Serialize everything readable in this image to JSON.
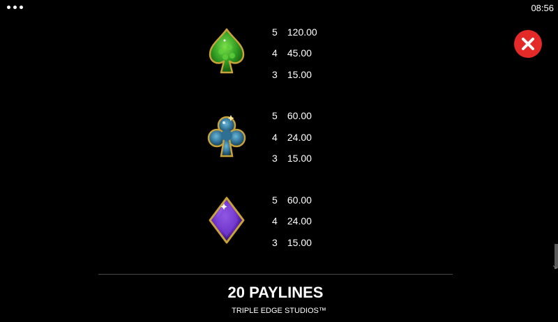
{
  "top_bar": {
    "clock": "08:56"
  },
  "colors": {
    "close_button": "#e32a28",
    "spade": "#3fae2a",
    "club": "#3a7fa8",
    "diamond": "#7a3fd0",
    "gold_border": "#c9a23a"
  },
  "paytable": [
    {
      "symbol": "spade-icon",
      "rows": [
        {
          "count": "5",
          "value": "120.00"
        },
        {
          "count": "4",
          "value": "45.00"
        },
        {
          "count": "3",
          "value": "15.00"
        }
      ]
    },
    {
      "symbol": "club-icon",
      "rows": [
        {
          "count": "5",
          "value": "60.00"
        },
        {
          "count": "4",
          "value": "24.00"
        },
        {
          "count": "3",
          "value": "15.00"
        }
      ]
    },
    {
      "symbol": "diamond-icon",
      "rows": [
        {
          "count": "5",
          "value": "60.00"
        },
        {
          "count": "4",
          "value": "24.00"
        },
        {
          "count": "3",
          "value": "15.00"
        }
      ]
    }
  ],
  "footer": {
    "paylines": "20 PAYLINES",
    "studio": "TRIPLE EDGE STUDIOS™"
  }
}
